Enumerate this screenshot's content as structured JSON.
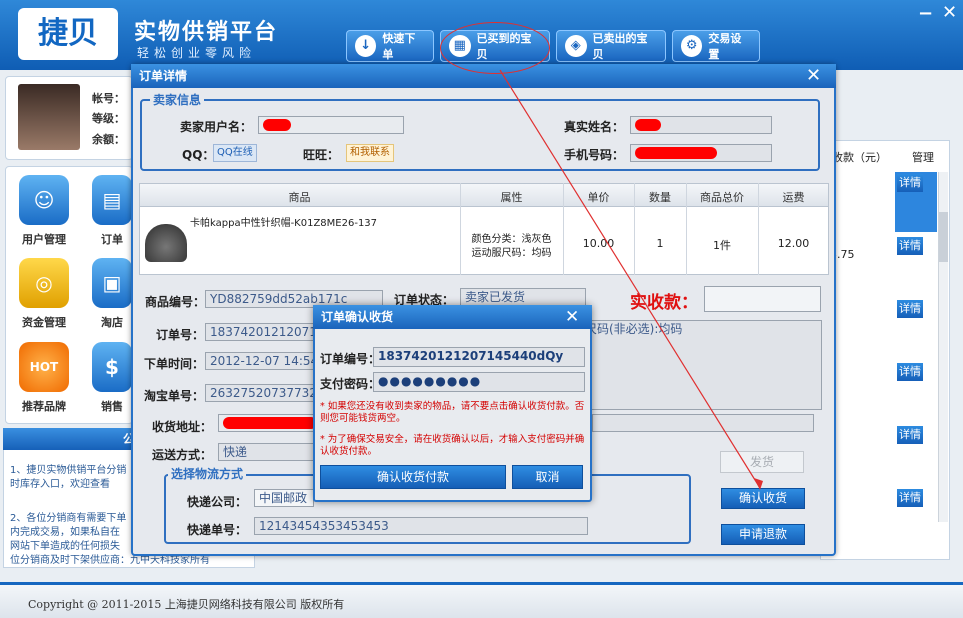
{
  "app": {
    "logo": "捷贝",
    "brand": "实物供销平台",
    "slogan": "轻松创业零风险",
    "win_min": "−",
    "win_close": "✕"
  },
  "nav": [
    {
      "label": "快速下单",
      "icon": "download-arrow-icon"
    },
    {
      "label": "已买到的宝贝",
      "icon": "basket-icon"
    },
    {
      "label": "已卖出的宝贝",
      "icon": "sale-tag-icon"
    },
    {
      "label": "交易设置",
      "icon": "settings-icon"
    }
  ],
  "user": {
    "account_label": "帐号：",
    "level_label": "等级：",
    "balance_label": "余额："
  },
  "menu": [
    {
      "label": "用户管理",
      "icon": "user-icon"
    },
    {
      "label": "订单",
      "icon": "order-icon"
    },
    {
      "label": "资金管理",
      "icon": "coins-icon"
    },
    {
      "label": "淘店",
      "icon": "shop-icon"
    },
    {
      "label": "推荐品牌",
      "icon": "hot-icon",
      "badge": "HOT"
    },
    {
      "label": "销售",
      "icon": "sales-icon"
    }
  ],
  "notice": {
    "title": "公",
    "lines": [
      "1、捷贝实物供销平台分销",
      "时库存入口，欢迎查看",
      "2、各位分销商有需要下单",
      "内完成交易，如果私自在",
      "网站下单造成的任何损失",
      "位分销商及时下架供应商：九中天科技家所有"
    ]
  },
  "right_table": {
    "col_amount": "收款（元）",
    "col_manage": "管理",
    "partial_value": "3.75",
    "detail_label": "详情"
  },
  "footer": {
    "copyright": "Copyright @ 2011-2015 上海捷贝网络科技有限公司 版权所有"
  },
  "order_dialog": {
    "title": "订单详情",
    "close": "✕",
    "seller_legend": "卖家信息",
    "seller_username_label": "卖家用户名：",
    "real_name_label": "真实姓名：",
    "qq_label": "QQ：",
    "qq_btn": "QQ在线",
    "wangwang_label": "旺旺：",
    "wangwang_btn": "和我联系",
    "phone_label": "手机号码：",
    "table_headers": [
      "商品",
      "属性",
      "单价",
      "数量",
      "商品总价",
      "运费"
    ],
    "product": {
      "name": "卡帕kappa中性针织帽-K01Z8ME26-137",
      "attr1": "颜色分类：浅灰色",
      "attr2": "运动服尺码：均码",
      "price": "10.00",
      "qty": "1",
      "total": "1件",
      "freight": "12.00"
    },
    "goods_no_label": "商品编号：",
    "goods_no": "YD882759dd52ab171c",
    "status_label": "订单状态：",
    "status": "卖家已发货",
    "received_label": "实收款：",
    "order_no_label": "订单号：",
    "order_no": "1837420121207145440dQy",
    "order_time_label": "下单时间：",
    "order_time": "2012-12-07 14:54:40",
    "taobao_no_label": "淘宝单号：",
    "taobao_no": "263275207377323",
    "attr_summary": "尺码(非必选):均码",
    "address_label": "收货地址：",
    "shipping_label": "运送方式：",
    "shipping": "快递",
    "logistics_legend": "选择物流方式",
    "courier_label": "快递公司：",
    "courier": "中国邮政",
    "tracking_label": "快递单号：",
    "tracking": "12143454353453453",
    "btn_ship": "发货",
    "btn_confirm": "确认收货",
    "btn_refund": "申请退款"
  },
  "confirm_dialog": {
    "title": "订单确认收货",
    "close": "✕",
    "order_no_label": "订单编号：",
    "order_no": "1837420121207145440dQy",
    "pay_pwd_label": "支付密码：",
    "pay_pwd": "●●●●●●●●●",
    "warn1": "* 如果您还没有收到卖家的物品，请不要点击确认收货付款。否则您可能钱货两空。",
    "warn2": "* 为了确保交易安全，请在收货确认以后，才输入支付密码并确认收货付款。",
    "btn_confirm_pay": "确认收货付款",
    "btn_cancel": "取消"
  },
  "colors": {
    "accent": "#1a63bb",
    "warning": "#d40000",
    "annotation": "#e03030"
  }
}
